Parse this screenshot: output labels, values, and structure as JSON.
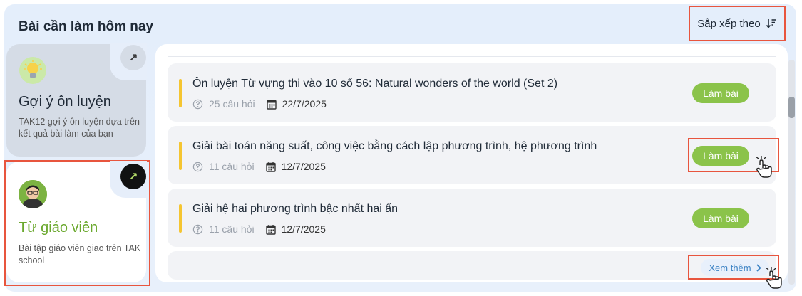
{
  "panel": {
    "title": "Bài cần làm hôm nay",
    "sort_label": "Sắp xếp theo"
  },
  "cards": {
    "suggest": {
      "title": "Gợi ý ôn luyện",
      "desc": "TAK12 gợi ý ôn luyện dựa trên kết quả bài làm của bạn",
      "arrow": "↗"
    },
    "teacher": {
      "title": "Từ giáo viên",
      "desc": "Bài tập giáo viên giao trên TAK school",
      "arrow": "↗"
    }
  },
  "tasks": [
    {
      "title": "Ôn luyện Từ vựng thi vào 10 số 56: Natural wonders of the world (Set 2)",
      "questions": "25 câu hỏi",
      "date": "22/7/2025",
      "action": "Làm bài"
    },
    {
      "title": "Giải bài toán năng suất, công việc bằng cách lập phương trình, hệ phương trình",
      "questions": "11 câu hỏi",
      "date": "12/7/2025",
      "action": "Làm bài"
    },
    {
      "title": "Giải hệ hai phương trình bậc nhất hai ẩn",
      "questions": "11 câu hỏi",
      "date": "12/7/2025",
      "action": "Làm bài"
    }
  ],
  "more_label": "Xem thêm",
  "colors": {
    "accent_green": "#8bc34a",
    "highlight_red": "#e8553e",
    "bar_yellow": "#f5c531",
    "link_blue": "#3b82c4"
  },
  "icons": [
    "sort-icon",
    "arrow-up-right-icon",
    "lightbulb-icon",
    "teacher-avatar",
    "question-circle-icon",
    "calendar-icon",
    "chevron-right-icon",
    "hand-pointer-icon"
  ]
}
